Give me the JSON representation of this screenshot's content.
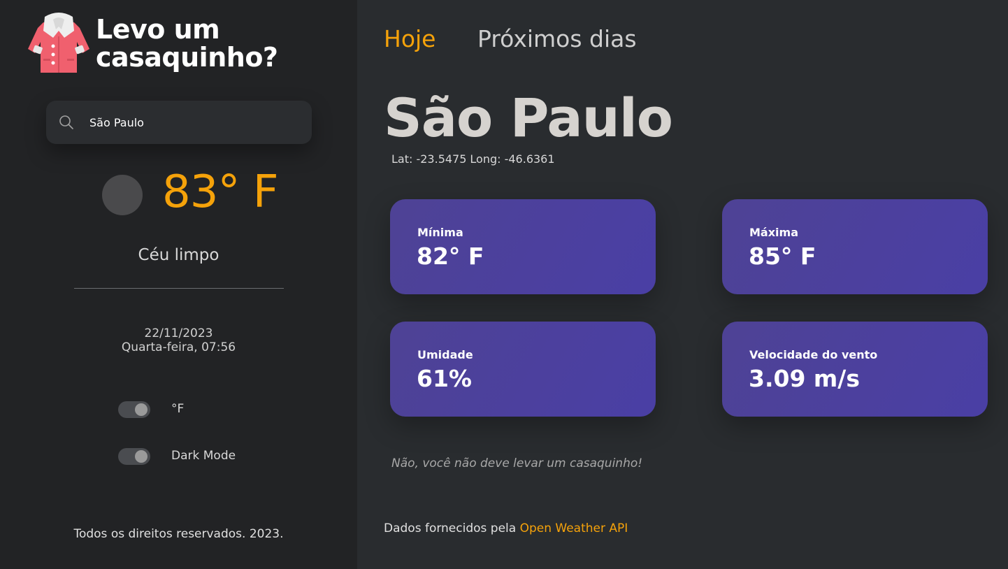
{
  "brand": {
    "line1": "Levo um",
    "line2": "casaquinho?",
    "logo_icon": "coat-icon"
  },
  "search": {
    "value": "São Paulo",
    "icon": "search-icon"
  },
  "current": {
    "temperature": "83° F",
    "condition": "Céu limpo",
    "weather_icon": "clear-sky-icon",
    "date": "22/11/2023",
    "day_time": "Quarta-feira, 07:56"
  },
  "toggles": {
    "unit_label": "°F",
    "dark_mode_label": "Dark Mode"
  },
  "footer": {
    "copyright": "Todos os direitos reservados. 2023."
  },
  "tabs": [
    {
      "label": "Hoje"
    },
    {
      "label": "Próximos dias"
    }
  ],
  "location": {
    "city": "São Paulo",
    "lat": "Lat: -23.5475",
    "long": "Long: -46.6361"
  },
  "cards": [
    {
      "label": "Mínima",
      "value": "82° F"
    },
    {
      "label": "Máxima",
      "value": "85° F"
    },
    {
      "label": "Umidade",
      "value": "61%"
    },
    {
      "label": "Velocidade do vento",
      "value": "3.09 m/s"
    }
  ],
  "advice": "Não, você não deve levar um casaquinho!",
  "credits": {
    "prefix": "Dados fornecidos pela",
    "link_text": "Open Weather API"
  },
  "colors": {
    "accent": "#f5a20a",
    "card": "#4b40a0",
    "sidebar": "#222325",
    "main": "#292c2f"
  }
}
